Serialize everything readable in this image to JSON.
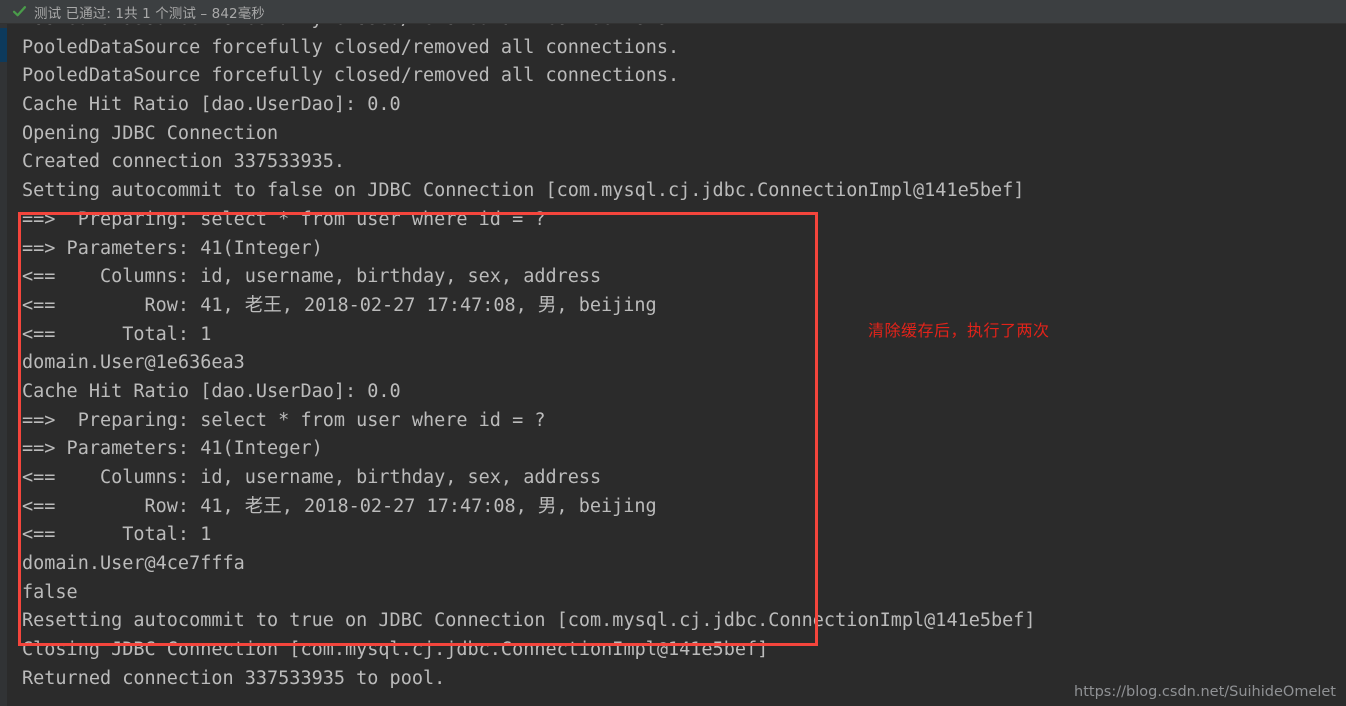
{
  "status_bar": {
    "icon": "check-mark-icon",
    "icon_color": "#4a9c4a",
    "text": "测试 已通过: 1共 1 个测试 – 842毫秒"
  },
  "console": {
    "background_color": "#2b2b2b",
    "text_color": "#bbbbbb",
    "lines": [
      "PooledDataSource forcefully closed/removed all connections.",
      "PooledDataSource forcefully closed/removed all connections.",
      "PooledDataSource forcefully closed/removed all connections.",
      "Cache Hit Ratio [dao.UserDao]: 0.0",
      "Opening JDBC Connection",
      "Created connection 337533935.",
      "Setting autocommit to false on JDBC Connection [com.mysql.cj.jdbc.ConnectionImpl@141e5bef]",
      "==>  Preparing: select * from user where id = ?",
      "==> Parameters: 41(Integer)",
      "<==    Columns: id, username, birthday, sex, address",
      "<==        Row: 41, 老王, 2018-02-27 17:47:08, 男, beijing",
      "<==      Total: 1",
      "domain.User@1e636ea3",
      "Cache Hit Ratio [dao.UserDao]: 0.0",
      "==>  Preparing: select * from user where id = ?",
      "==> Parameters: 41(Integer)",
      "<==    Columns: id, username, birthday, sex, address",
      "<==        Row: 41, 老王, 2018-02-27 17:47:08, 男, beijing",
      "<==      Total: 1",
      "domain.User@4ce7fffa",
      "false",
      "Resetting autocommit to true on JDBC Connection [com.mysql.cj.jdbc.ConnectionImpl@141e5bef]",
      "Closing JDBC Connection [com.mysql.cj.jdbc.ConnectionImpl@141e5bef]",
      "Returned connection 337533935 to pool."
    ]
  },
  "annotation": {
    "label": "清除缓存后，执行了两次",
    "color": "#e2231a",
    "box_color": "#f4453c"
  },
  "watermark": {
    "text": "https://blog.csdn.net/SuihideOmelet"
  }
}
